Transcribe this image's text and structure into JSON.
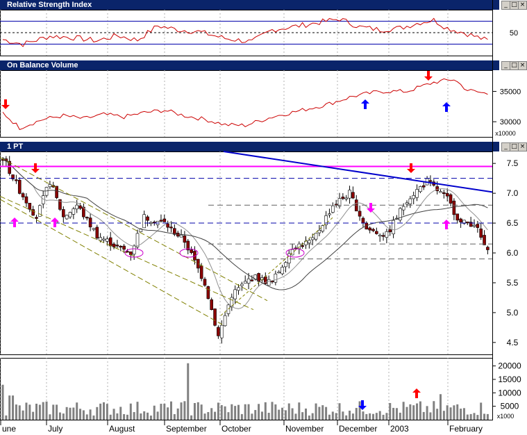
{
  "panels": {
    "rsi": {
      "title": "Relative Strength Index",
      "ticks": [
        "50"
      ]
    },
    "obv": {
      "title": "On Balance Volume",
      "ticks": [
        "35000",
        "30000"
      ],
      "multiplier": "x10000"
    },
    "price": {
      "title": "1 PT",
      "ticks": [
        "7.5",
        "7.0",
        "6.5",
        "6.0",
        "5.5",
        "5.0",
        "4.5"
      ]
    },
    "volume": {
      "ticks": [
        "20000",
        "15000",
        "10000",
        "5000"
      ],
      "multiplier": "x1000"
    }
  },
  "window_buttons": {
    "minimize": "_",
    "maximize": "□",
    "close": "×"
  },
  "x_labels": [
    "une",
    "July",
    "August",
    "September",
    "October",
    "November",
    "December",
    "2003",
    "February"
  ],
  "colors": {
    "title_bar": "#0a246a",
    "rsi_line": "#cc0000",
    "obv_line": "#cc0000",
    "candle_up": "#ffffff",
    "candle_down": "#8b0000",
    "trend_line": "#0000cc",
    "resistance": "#ff00ff",
    "channel": "#808000",
    "volume_bar": "#808080",
    "arrow_red": "#ff0000",
    "arrow_blue": "#0000ff",
    "arrow_magenta": "#ff00ff"
  },
  "chart_data": [
    {
      "type": "line",
      "name": "rsi",
      "title": "Relative Strength Index",
      "y_ticks": [
        50
      ],
      "reference_lines": [
        30,
        50,
        70
      ],
      "trend": [
        {
          "x": "June",
          "y": 38
        },
        {
          "x": "mid June",
          "y": 30
        },
        {
          "x": "late June",
          "y": 45
        },
        {
          "x": "July",
          "y": 42
        },
        {
          "x": "mid July",
          "y": 38
        },
        {
          "x": "August",
          "y": 35
        },
        {
          "x": "mid August",
          "y": 45
        },
        {
          "x": "late August",
          "y": 62
        },
        {
          "x": "September",
          "y": 52
        },
        {
          "x": "mid September",
          "y": 40
        },
        {
          "x": "October",
          "y": 32
        },
        {
          "x": "mid October",
          "y": 55
        },
        {
          "x": "November",
          "y": 68
        },
        {
          "x": "mid November",
          "y": 74
        },
        {
          "x": "December",
          "y": 58
        },
        {
          "x": "mid December",
          "y": 52
        },
        {
          "x": "2003",
          "y": 70
        },
        {
          "x": "mid January",
          "y": 72
        },
        {
          "x": "February",
          "y": 45
        },
        {
          "x": "late February",
          "y": 36
        }
      ]
    },
    {
      "type": "line",
      "name": "obv",
      "title": "On Balance Volume",
      "y_unit": "x10000",
      "y_ticks": [
        30000,
        35000
      ],
      "trend": [
        {
          "x": "June",
          "y": 31500
        },
        {
          "x": "mid June",
          "y": 28800
        },
        {
          "x": "late June",
          "y": 30500
        },
        {
          "x": "July",
          "y": 30200
        },
        {
          "x": "mid July",
          "y": 31200
        },
        {
          "x": "August",
          "y": 30700
        },
        {
          "x": "mid August",
          "y": 31500
        },
        {
          "x": "late August",
          "y": 31900
        },
        {
          "x": "September",
          "y": 30800
        },
        {
          "x": "mid September",
          "y": 29400
        },
        {
          "x": "October",
          "y": 29600
        },
        {
          "x": "mid October",
          "y": 31200
        },
        {
          "x": "November",
          "y": 32500
        },
        {
          "x": "mid November",
          "y": 34200
        },
        {
          "x": "December",
          "y": 35000
        },
        {
          "x": "mid December",
          "y": 35000
        },
        {
          "x": "2003",
          "y": 36500
        },
        {
          "x": "mid January",
          "y": 37000
        },
        {
          "x": "late January",
          "y": 34800
        },
        {
          "x": "February",
          "y": 35800
        },
        {
          "x": "late February",
          "y": 34600
        }
      ]
    },
    {
      "type": "candlestick",
      "name": "price",
      "title": "1 PT",
      "y_ticks": [
        4.5,
        5.0,
        5.5,
        6.0,
        6.5,
        7.0,
        7.5
      ],
      "ylim": [
        4.3,
        7.7
      ],
      "x_labels": [
        "une",
        "July",
        "August",
        "September",
        "October",
        "November",
        "December",
        "2003",
        "February"
      ],
      "horizontal_lines": [
        7.45,
        7.25,
        6.8,
        6.5,
        6.15,
        5.9
      ],
      "trend": [
        {
          "x": "June",
          "y": 7.6
        },
        {
          "x": "mid June",
          "y": 6.6
        },
        {
          "x": "late June",
          "y": 7.2
        },
        {
          "x": "July",
          "y": 6.6
        },
        {
          "x": "mid July",
          "y": 6.8
        },
        {
          "x": "August",
          "y": 6.1
        },
        {
          "x": "mid August",
          "y": 6.0
        },
        {
          "x": "late August",
          "y": 6.6
        },
        {
          "x": "September",
          "y": 6.2
        },
        {
          "x": "mid September",
          "y": 5.4
        },
        {
          "x": "late September",
          "y": 4.6
        },
        {
          "x": "October",
          "y": 5.6
        },
        {
          "x": "mid October",
          "y": 5.4
        },
        {
          "x": "November",
          "y": 6.4
        },
        {
          "x": "mid November",
          "y": 6.9
        },
        {
          "x": "December",
          "y": 6.4
        },
        {
          "x": "mid December",
          "y": 6.3
        },
        {
          "x": "2003",
          "y": 7.1
        },
        {
          "x": "mid January",
          "y": 7.0
        },
        {
          "x": "February",
          "y": 6.5
        },
        {
          "x": "late February",
          "y": 6.0
        }
      ]
    },
    {
      "type": "bar",
      "name": "volume",
      "y_unit": "x1000",
      "y_ticks": [
        5000,
        10000,
        15000,
        20000
      ],
      "ylim": [
        0,
        23000
      ],
      "x_labels": [
        "une",
        "July",
        "August",
        "September",
        "October",
        "November",
        "December",
        "2003",
        "February"
      ]
    }
  ]
}
